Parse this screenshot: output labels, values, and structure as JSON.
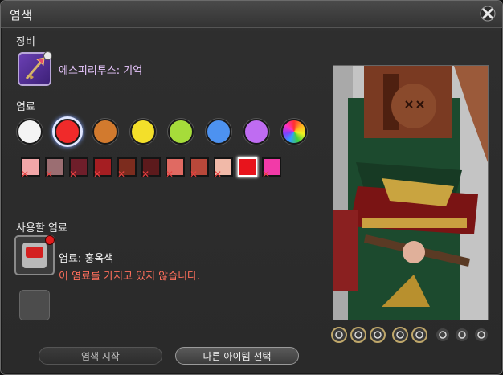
{
  "window": {
    "title": "염색"
  },
  "equipment": {
    "section_label": "장비",
    "item_name": "에스피리투스: 기억",
    "item_icon": "staff-icon"
  },
  "dyes": {
    "section_label": "염료",
    "categories": [
      {
        "name": "white",
        "color": "#f4f4f4"
      },
      {
        "name": "red",
        "color": "#f02a2a"
      },
      {
        "name": "brown",
        "color": "#d27a2e"
      },
      {
        "name": "yellow",
        "color": "#f3df2a"
      },
      {
        "name": "green",
        "color": "#a6dc3a"
      },
      {
        "name": "blue",
        "color": "#4d92f0"
      },
      {
        "name": "purple",
        "color": "#bf6cf2"
      },
      {
        "name": "rainbow",
        "color": "rainbow"
      }
    ],
    "selected_category": 1,
    "chips": [
      {
        "color": "#f2a6a8",
        "locked": true
      },
      {
        "color": "#9b6e72",
        "locked": true
      },
      {
        "color": "#6e1e2a",
        "locked": true
      },
      {
        "color": "#a51e22",
        "locked": true
      },
      {
        "color": "#7c2c1e",
        "locked": true
      },
      {
        "color": "#5c1a1c",
        "locked": true
      },
      {
        "color": "#e06a62",
        "locked": true
      },
      {
        "color": "#b8483a",
        "locked": true
      },
      {
        "color": "#f1b9a8",
        "locked": true
      },
      {
        "color": "#e8141c",
        "locked": false
      },
      {
        "color": "#f23aa8",
        "locked": true
      }
    ],
    "selected_chip": 9
  },
  "use_dye": {
    "section_label": "사용할 염료",
    "dye_name": "염료: 홍옥색",
    "warning": "이 염료를 가지고 있지 않습니다."
  },
  "preview_controls": [
    {
      "icon": "weapon-icon"
    },
    {
      "icon": "hat-icon"
    },
    {
      "icon": "visor-icon"
    },
    {
      "icon": "figure-icon"
    },
    {
      "icon": "camera-icon"
    },
    {
      "icon": "lighting-icon"
    },
    {
      "icon": "eye-icon"
    },
    {
      "icon": "reset-icon"
    }
  ],
  "buttons": {
    "start_dye": "염색 시작",
    "select_other_item": "다른 아이템 선택"
  },
  "colors": {
    "accent_gold": "#bfa76a",
    "warning": "#ff6f5c",
    "item_name": "#e9c7ff"
  }
}
